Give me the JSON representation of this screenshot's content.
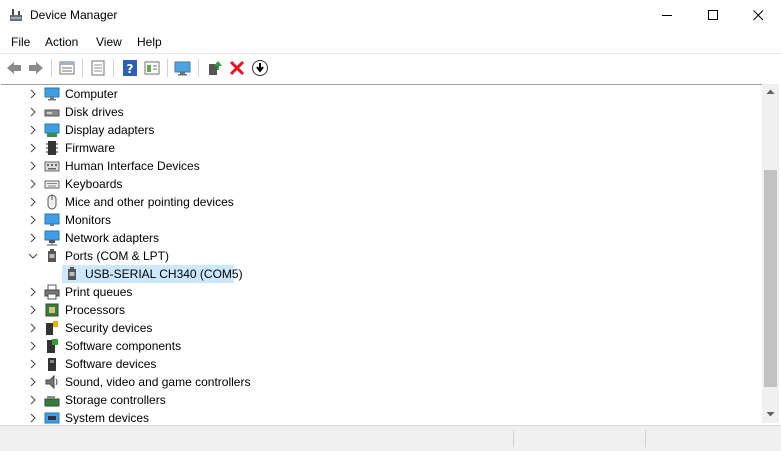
{
  "window": {
    "title": "Device Manager"
  },
  "menu": [
    "File",
    "Action",
    "View",
    "Help"
  ],
  "tree": [
    {
      "label": "Computer",
      "icon": "computer-icon"
    },
    {
      "label": "Disk drives",
      "icon": "disk-drive-icon"
    },
    {
      "label": "Display adapters",
      "icon": "display-adapter-icon"
    },
    {
      "label": "Firmware",
      "icon": "firmware-icon"
    },
    {
      "label": "Human Interface Devices",
      "icon": "hid-icon"
    },
    {
      "label": "Keyboards",
      "icon": "keyboard-icon"
    },
    {
      "label": "Mice and other pointing devices",
      "icon": "mouse-icon"
    },
    {
      "label": "Monitors",
      "icon": "monitor-icon"
    },
    {
      "label": "Network adapters",
      "icon": "network-adapter-icon"
    },
    {
      "label": "Ports (COM & LPT)",
      "icon": "port-icon"
    },
    {
      "label": "USB-SERIAL CH340 (COM5)",
      "icon": "port-icon"
    },
    {
      "label": "Print queues",
      "icon": "printer-icon"
    },
    {
      "label": "Processors",
      "icon": "processor-icon"
    },
    {
      "label": "Security devices",
      "icon": "security-device-icon"
    },
    {
      "label": "Software components",
      "icon": "software-component-icon"
    },
    {
      "label": "Software devices",
      "icon": "software-device-icon"
    },
    {
      "label": "Sound, video and game controllers",
      "icon": "speaker-icon"
    },
    {
      "label": "Storage controllers",
      "icon": "storage-controller-icon"
    },
    {
      "label": "System devices",
      "icon": "system-device-icon"
    }
  ],
  "colors": {
    "selection": "#cce8ff",
    "accent": "#1a73c7",
    "red": "#e81123"
  }
}
